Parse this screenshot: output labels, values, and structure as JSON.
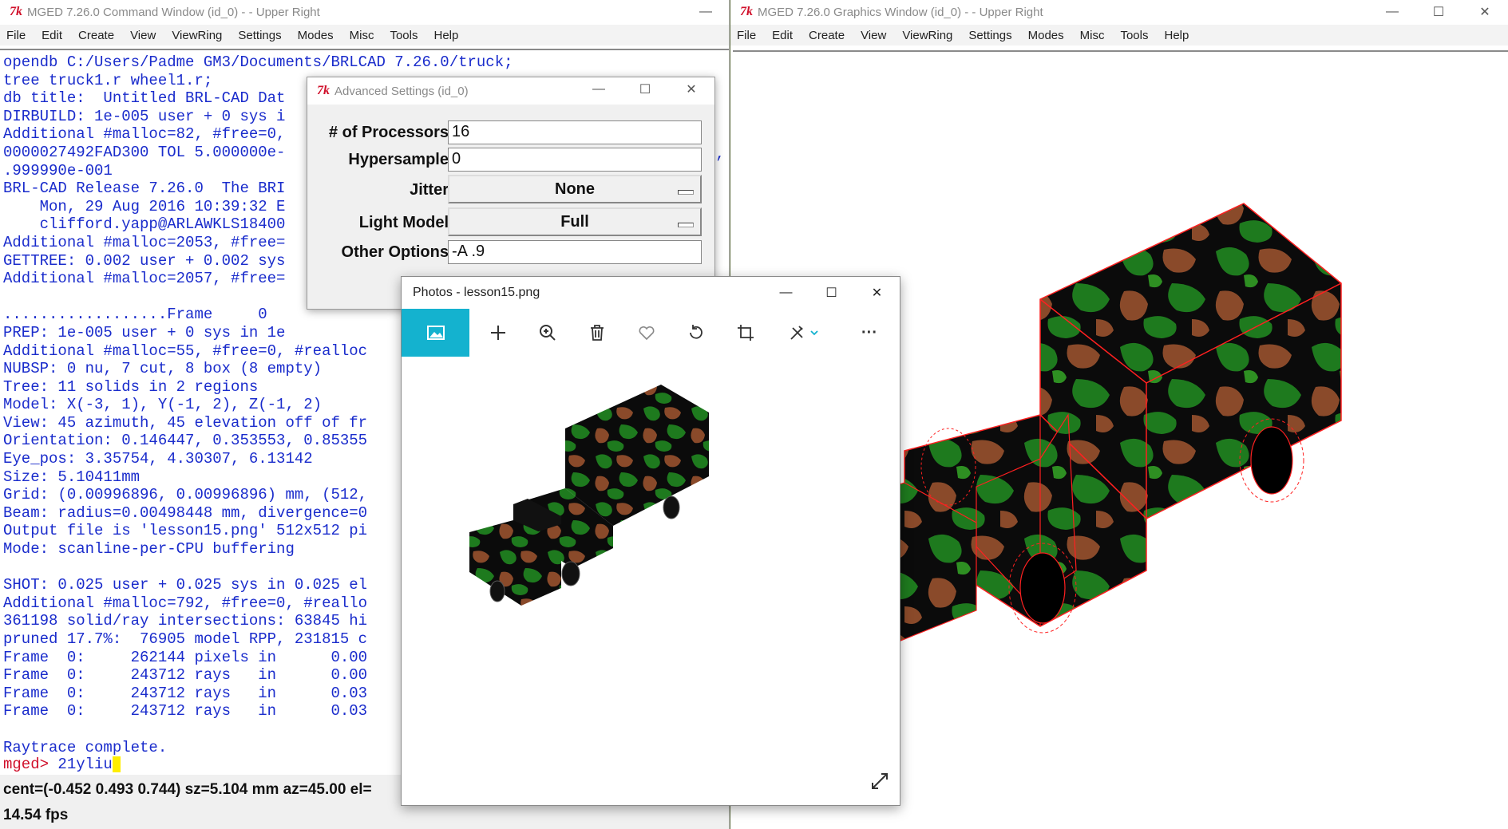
{
  "command_window": {
    "title": "MGED 7.26.0 Command Window (id_0) -  - Upper Right",
    "tk_logo": "7k",
    "menu": [
      "File",
      "Edit",
      "Create",
      "View",
      "ViewRing",
      "Settings",
      "Modes",
      "Misc",
      "Tools",
      "Help"
    ],
    "console_lines": [
      "opendb C:/Users/Padme GM3/Documents/BRLCAD 7.26.0/truck;",
      "tree truck1.r wheel1.r;",
      "db title:  Untitled BRL-CAD Dat",
      "DIRBUILD: 1e-005 user + 0 sys i",
      "Additional #malloc=82, #free=0,",
      "0000027492FAD300 TOL 5.000000e-",
      ".999990e-001",
      "BRL-CAD Release 7.26.0  The BRI",
      "    Mon, 29 Aug 2016 10:39:32 E",
      "    clifford.yapp@ARLAWKLS18400",
      "Additional #malloc=2053, #free=",
      "GETTREE: 0.002 user + 0.002 sys",
      "Additional #malloc=2057, #free=",
      "",
      "..................Frame     0",
      "PREP: 1e-005 user + 0 sys in 1e",
      "Additional #malloc=55, #free=0, #realloc",
      "NUBSP: 0 nu, 7 cut, 8 box (8 empty)",
      "Tree: 11 solids in 2 regions",
      "Model: X(-3, 1), Y(-1, 2), Z(-1, 2)",
      "View: 45 azimuth, 45 elevation off of fr",
      "Orientation: 0.146447, 0.353553, 0.85355",
      "Eye_pos: 3.35754, 4.30307, 6.13142",
      "Size: 5.10411mm",
      "Grid: (0.00996896, 0.00996896) mm, (512,",
      "Beam: radius=0.00498448 mm, divergence=0",
      "Output file is 'lesson15.png' 512x512 pi",
      "Mode: scanline-per-CPU buffering",
      "",
      "SHOT: 0.025 user + 0.025 sys in 0.025 el",
      "Additional #malloc=792, #free=0, #reallo",
      "361198 solid/ray intersections: 63845 hi",
      "pruned 17.7%:  76905 model RPP, 231815 c",
      "Frame  0:     262144 pixels in      0.00",
      "Frame  0:     243712 rays   in      0.00",
      "Frame  0:     243712 rays   in      0.03",
      "Frame  0:     243712 rays   in      0.03",
      "",
      "Raytrace complete."
    ],
    "console_right_fragment": "6,",
    "prompt": "mged>",
    "prompt_input": " 21yliu",
    "status_line1": "cent=(-0.452 0.493 0.744) sz=5.104  mm  az=45.00  el=",
    "status_line2": "14.54 fps"
  },
  "graphics_window": {
    "title": "MGED 7.26.0 Graphics Window (id_0) -  - Upper Right",
    "menu": [
      "File",
      "Edit",
      "Create",
      "View",
      "ViewRing",
      "Settings",
      "Modes",
      "Misc",
      "Tools",
      "Help"
    ]
  },
  "advanced_settings": {
    "title": "Advanced Settings (id_0)",
    "processors_label": "# of Processors",
    "processors_value": "16",
    "hypersample_label": "Hypersample",
    "hypersample_value": "0",
    "jitter_label": "Jitter",
    "jitter_value": "None",
    "light_model_label": "Light Model",
    "light_model_value": "Full",
    "other_options_label": "Other Options",
    "other_options_value": "-A .9"
  },
  "photos": {
    "title": "Photos - lesson15.png",
    "toolbar_icons": [
      "view-image-icon",
      "add-icon",
      "zoom-icon",
      "delete-icon",
      "favorite-icon",
      "rotate-icon",
      "crop-icon",
      "edit-icon",
      "more-icon"
    ],
    "more_label": "···"
  },
  "window_buttons": {
    "minimize": "—",
    "maximize": "☐",
    "close": "✕"
  },
  "colors": {
    "console_text": "#1a2ccc",
    "prompt": "#d0102b",
    "photos_accent": "#14b2cf",
    "wireframe": "#ff2020",
    "camo_green": "#1e7a1e",
    "camo_brown": "#8a4a2a"
  }
}
